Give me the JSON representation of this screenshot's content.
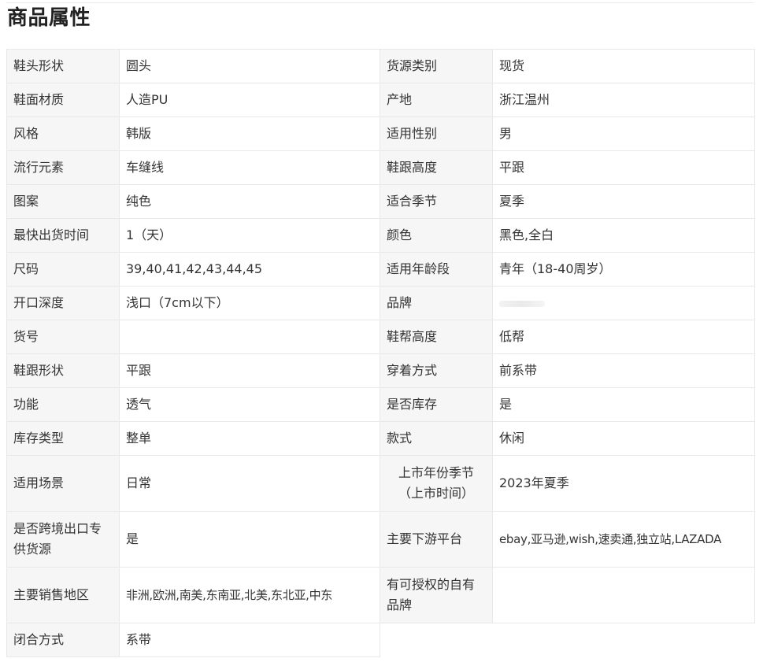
{
  "section": {
    "title": "商品属性"
  },
  "rows": [
    {
      "k1": "鞋头形状",
      "v1": "圆头",
      "k2": "货源类别",
      "v2": "现货"
    },
    {
      "k1": "鞋面材质",
      "v1": "人造PU",
      "k2": "产地",
      "v2": "浙江温州"
    },
    {
      "k1": "风格",
      "v1": "韩版",
      "k2": "适用性别",
      "v2": "男"
    },
    {
      "k1": "流行元素",
      "v1": "车缝线",
      "k2": "鞋跟高度",
      "v2": "平跟"
    },
    {
      "k1": "图案",
      "v1": "纯色",
      "k2": "适合季节",
      "v2": "夏季"
    },
    {
      "k1": "最快出货时间",
      "v1": "1（天）",
      "k2": "颜色",
      "v2": "黑色,全白"
    },
    {
      "k1": "尺码",
      "v1": "39,40,41,42,43,44,45",
      "k2": "适用年龄段",
      "v2": "青年（18-40周岁）"
    },
    {
      "k1": "开口深度",
      "v1": "浅口（7cm以下）",
      "k2": "品牌",
      "v2": ""
    },
    {
      "k1": "货号",
      "v1": "",
      "k2": "鞋帮高度",
      "v2": "低帮"
    },
    {
      "k1": "鞋跟形状",
      "v1": "平跟",
      "k2": "穿着方式",
      "v2": "前系带"
    },
    {
      "k1": "功能",
      "v1": "透气",
      "k2": "是否库存",
      "v2": "是"
    },
    {
      "k1": "库存类型",
      "v1": "整单",
      "k2": "款式",
      "v2": "休闲"
    },
    {
      "k1": "适用场景",
      "v1": "日常",
      "k2": "上市年份季节（上市时间）",
      "v2": "2023年夏季"
    },
    {
      "k1": "是否跨境出口专供货源",
      "v1": "是",
      "k2": "主要下游平台",
      "v2": "ebay,亚马逊,wish,速卖通,独立站,LAZADA"
    },
    {
      "k1": "主要销售地区",
      "v1": "非洲,欧洲,南美,东南亚,北美,东北亚,中东",
      "k2": "有可授权的自有品牌",
      "v2": ""
    },
    {
      "k1": "闭合方式",
      "v1": "系带"
    }
  ]
}
